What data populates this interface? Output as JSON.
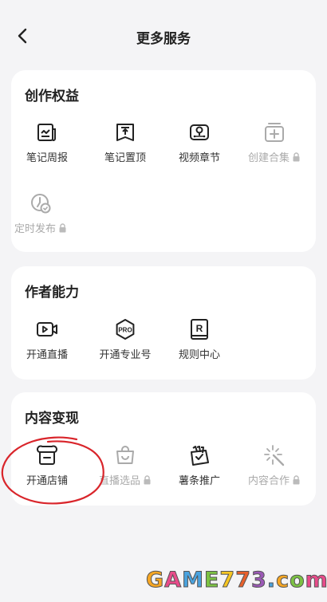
{
  "header": {
    "title": "更多服务",
    "back_icon": "chevron-left-icon"
  },
  "sections": [
    {
      "title": "创作权益",
      "items": [
        {
          "label": "笔记周报",
          "icon": "chart-report-icon",
          "locked": false
        },
        {
          "label": "笔记置顶",
          "icon": "pin-top-icon",
          "locked": false
        },
        {
          "label": "视频章节",
          "icon": "video-chapter-icon",
          "locked": false
        },
        {
          "label": "创建合集",
          "icon": "collection-add-icon",
          "locked": true
        },
        {
          "label": "定时发布",
          "icon": "clock-check-icon",
          "locked": true
        }
      ]
    },
    {
      "title": "作者能力",
      "items": [
        {
          "label": "开通直播",
          "icon": "live-camera-icon",
          "locked": false
        },
        {
          "label": "开通专业号",
          "icon": "pro-badge-icon",
          "locked": false
        },
        {
          "label": "规则中心",
          "icon": "rules-book-icon",
          "locked": false
        }
      ]
    },
    {
      "title": "内容变现",
      "items": [
        {
          "label": "开通店铺",
          "icon": "store-icon",
          "locked": false
        },
        {
          "label": "直播选品",
          "icon": "shopping-bag-icon",
          "locked": true
        },
        {
          "label": "薯条推广",
          "icon": "fries-promo-icon",
          "locked": false
        },
        {
          "label": "内容合作",
          "icon": "sparkle-wand-icon",
          "locked": true
        }
      ]
    }
  ],
  "watermark": {
    "text": "GAME773.com"
  },
  "colors": {
    "background": "#f4f4f6",
    "card": "#ffffff",
    "disabled": "#aaaaaa",
    "annotation": "#d9252b"
  }
}
